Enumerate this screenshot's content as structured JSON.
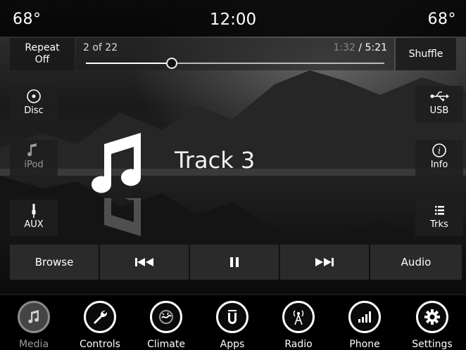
{
  "status": {
    "temp_left": "68°",
    "clock": "12:00",
    "temp_right": "68°"
  },
  "playback": {
    "repeat_label": "Repeat",
    "repeat_state": "Off",
    "track_position": "2 of 22",
    "time_elapsed": "1:32",
    "time_separator": " / ",
    "time_total": "5:21",
    "progress_fraction": 0.2866,
    "shuffle_label": "Shuffle",
    "track_title": "Track 3"
  },
  "sources_left": [
    {
      "label": "Disc",
      "icon": "disc-icon",
      "active": true
    },
    {
      "label": "iPod",
      "icon": "music-note-icon",
      "active": false
    },
    {
      "label": "AUX",
      "icon": "aux-plug-icon",
      "active": true
    }
  ],
  "sources_right": [
    {
      "label": "USB",
      "icon": "usb-icon"
    },
    {
      "label": "Info",
      "icon": "info-icon"
    },
    {
      "label": "Trks",
      "icon": "list-icon"
    }
  ],
  "transport": {
    "browse": "Browse",
    "previous_icon": "skip-previous-icon",
    "pause_icon": "pause-icon",
    "next_icon": "skip-next-icon",
    "audio": "Audio"
  },
  "nav": [
    {
      "label": "Media",
      "icon": "music-note-icon",
      "active": true
    },
    {
      "label": "Controls",
      "icon": "wrench-icon",
      "active": false
    },
    {
      "label": "Climate",
      "icon": "climate-icon",
      "active": false
    },
    {
      "label": "Apps",
      "icon": "apps-icon",
      "active": false
    },
    {
      "label": "Radio",
      "icon": "radio-antenna-icon",
      "active": false
    },
    {
      "label": "Phone",
      "icon": "phone-signal-icon",
      "active": false
    },
    {
      "label": "Settings",
      "icon": "gear-icon",
      "active": false
    }
  ],
  "colors": {
    "background": "#000000",
    "button": "#2d2d2d",
    "text": "#ffffff",
    "inactive_text": "#9a9a9a"
  }
}
